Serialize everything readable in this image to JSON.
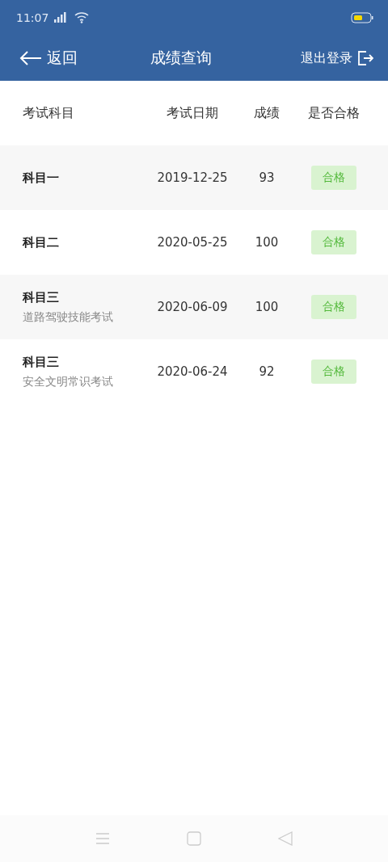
{
  "status_bar": {
    "time": "11:07"
  },
  "top_bar": {
    "back": "返回",
    "title": "成绩查询",
    "logout": "退出登录"
  },
  "table": {
    "columns": [
      "考试科目",
      "考试日期",
      "成绩",
      "是否合格"
    ],
    "rows": [
      {
        "subject": "科目一",
        "date": "2019-12-25",
        "score": "93",
        "result": {
          "label": "合格",
          "passed": true
        }
      },
      {
        "subject": "科目二",
        "date": "2020-05-25",
        "score": "100",
        "result": {
          "label": "合格",
          "passed": true
        }
      },
      {
        "subject": "科目三",
        "subtitle": "道路驾驶技能考试",
        "date": "2020-06-09",
        "score": "100",
        "result": {
          "label": "合格",
          "passed": true
        }
      },
      {
        "subject": "科目三",
        "subtitle": "安全文明常识考试",
        "date": "2020-06-24",
        "score": "92",
        "result": {
          "label": "合格",
          "passed": true
        }
      }
    ]
  }
}
